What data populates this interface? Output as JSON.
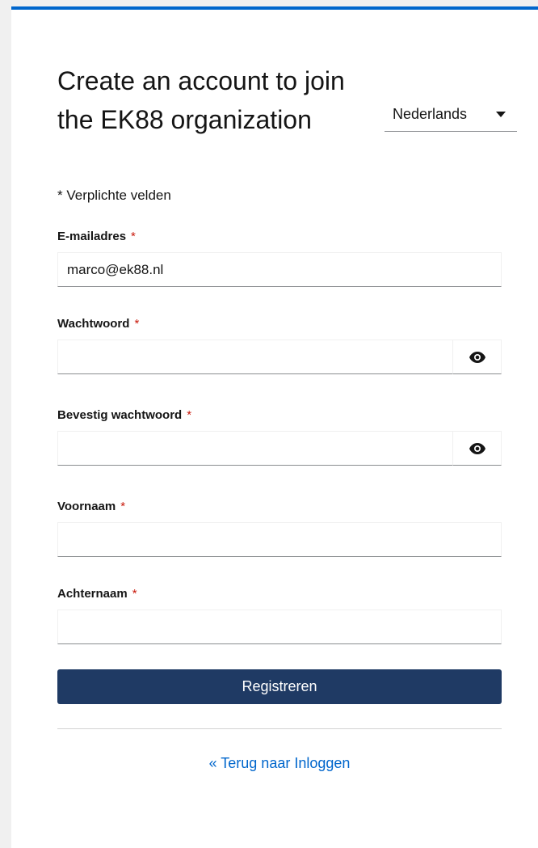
{
  "header": {
    "title": "Create an account to join the EK88 organization",
    "language": "Nederlands"
  },
  "form": {
    "required_note": "* Verplichte velden",
    "required_marker": "*",
    "email": {
      "label": "E-mailadres",
      "value": "marco@ek88.nl"
    },
    "password": {
      "label": "Wachtwoord",
      "value": ""
    },
    "confirm_password": {
      "label": "Bevestig wachtwoord",
      "value": ""
    },
    "first_name": {
      "label": "Voornaam",
      "value": ""
    },
    "last_name": {
      "label": "Achternaam",
      "value": ""
    },
    "submit_label": "Registreren"
  },
  "footer": {
    "back_link": "« Terug naar Inloggen"
  },
  "icons": {
    "password_toggle": "eye-icon",
    "language_dropdown": "caret-down-icon"
  },
  "colors": {
    "accent": "#0066cc",
    "primary_button": "#1f3a64",
    "required": "#c9190b"
  }
}
